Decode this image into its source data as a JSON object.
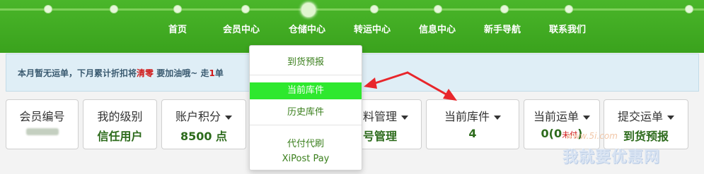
{
  "nav": {
    "items": [
      "首页",
      "会员中心",
      "仓储中心",
      "转运中心",
      "信息中心",
      "新手导航",
      "联系我们"
    ]
  },
  "notice": {
    "prefix": "本月暂无运单，下月累计折扣将",
    "highlight": "清零",
    "middle": " 要加油哦~ 走",
    "count": "1",
    "suffix": "单"
  },
  "cards": [
    {
      "label": "会员编号",
      "value": "",
      "dropdown": false
    },
    {
      "label": "我的级别",
      "value": "信任用户",
      "dropdown": false
    },
    {
      "label": "账户积分",
      "value": "8500 点",
      "dropdown": true
    },
    {
      "label": "料管理",
      "value": "号管理",
      "dropdown": true
    },
    {
      "label": "当前库件",
      "value": "4",
      "dropdown": true
    },
    {
      "label": "当前运单",
      "value": "0(0",
      "value_small": "未付",
      "value_suffix": ")",
      "dropdown": true
    },
    {
      "label": "提交运单",
      "value": "到货预报",
      "dropdown": true
    }
  ],
  "dropdown_menu": {
    "items": [
      "到货预报",
      "当前库件",
      "历史库件",
      "代付代刷",
      "XiPost Pay"
    ],
    "active_index": 1
  },
  "annotation": {
    "arrow_color": "#e8262b"
  },
  "watermark": {
    "url": "www.5i.com",
    "text": "我就要优惠网"
  },
  "colors": {
    "nav_green": "#3aa21d",
    "value_green": "#2d6b1c",
    "active_item": "#2ee82e",
    "alert_red": "#d01a1a"
  }
}
